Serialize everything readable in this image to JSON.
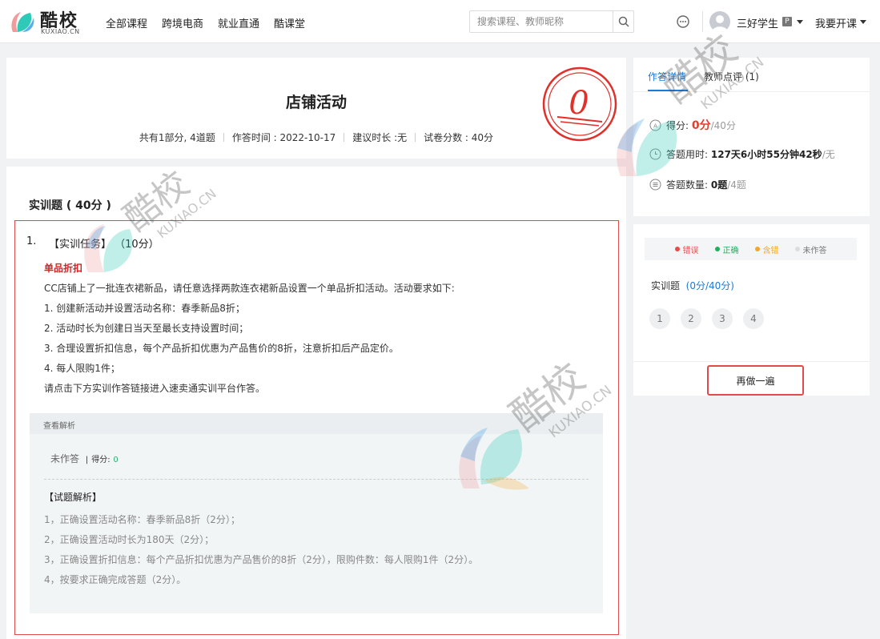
{
  "header": {
    "logo_text": "酷校",
    "logo_sub": "KUXIAO.CN",
    "nav": [
      "全部课程",
      "跨境电商",
      "就业直通",
      "酷课堂"
    ],
    "search_placeholder": "搜索课程、教师昵称",
    "user_name": "三好学生",
    "user_badge": "P",
    "open_course": "我要开课"
  },
  "exam": {
    "title": "店铺活动",
    "meta": [
      "共有1部分, 4道题",
      "作答时间 : 2022-10-17",
      "建议时长 :无",
      "试卷分数 : 40分"
    ],
    "score_stamp": "0"
  },
  "section": {
    "title": "实训题 ( 40分 )"
  },
  "question": {
    "number": "1.",
    "head": "【实训任务】 （10分）",
    "subtitle": "单品折扣",
    "body": [
      "CC店铺上了一批连衣裙新品，请任意选择两款连衣裙新品设置一个单品折扣活动。活动要求如下:",
      "1. 创建新活动并设置活动名称：春季新品8折；",
      "2. 活动时长为创建日当天至最长支持设置时间；",
      "3. 合理设置折扣信息，每个产品折扣优惠为产品售价的8折，注意折扣后产品定价。",
      "4. 每人限购1件；",
      "请点击下方实训作答链接进入速卖通实训平台作答。"
    ],
    "analysis_label": "查看解析",
    "answer_status": "未作答",
    "score_label": "得分:",
    "score_value": "0",
    "explain_title": "【试题解析】",
    "explain": [
      "1，正确设置活动名称：春季新品8折（2分）；",
      "2，正确设置活动时长为180天（2分）；",
      "3，正确设置折扣信息：每个产品折扣优惠为产品售价的8折（2分），限购件数：每人限购1件（2分）。",
      "4，按要求正确完成答题（2分）。"
    ]
  },
  "detail": {
    "tabs": [
      "作答详情",
      "教师点评 (1)"
    ],
    "score_label": "得分:",
    "score_value": "0分",
    "score_total": "/40分",
    "time_label": "答题用时:",
    "time_value": "127天6小时55分钟42秒",
    "time_suffix": "/无",
    "count_label": "答题数量:",
    "count_value": "0题",
    "count_total": "/4题"
  },
  "nav_panel": {
    "legend": [
      {
        "label": "错误",
        "color": "#e84a4a"
      },
      {
        "label": "正确",
        "color": "#1fb15a"
      },
      {
        "label": "含错",
        "color": "#f5a623"
      },
      {
        "label": "未作答",
        "color": "#dddddd"
      }
    ],
    "section_name": "实训题",
    "section_score": "(0分/40分)",
    "question_numbers": [
      "1",
      "2",
      "3",
      "4"
    ],
    "redo_label": "再做一遍"
  },
  "colors": {
    "accent_blue": "#1a7ad9",
    "highlight_red": "#e24b4b",
    "score_red": "#e0402d"
  }
}
